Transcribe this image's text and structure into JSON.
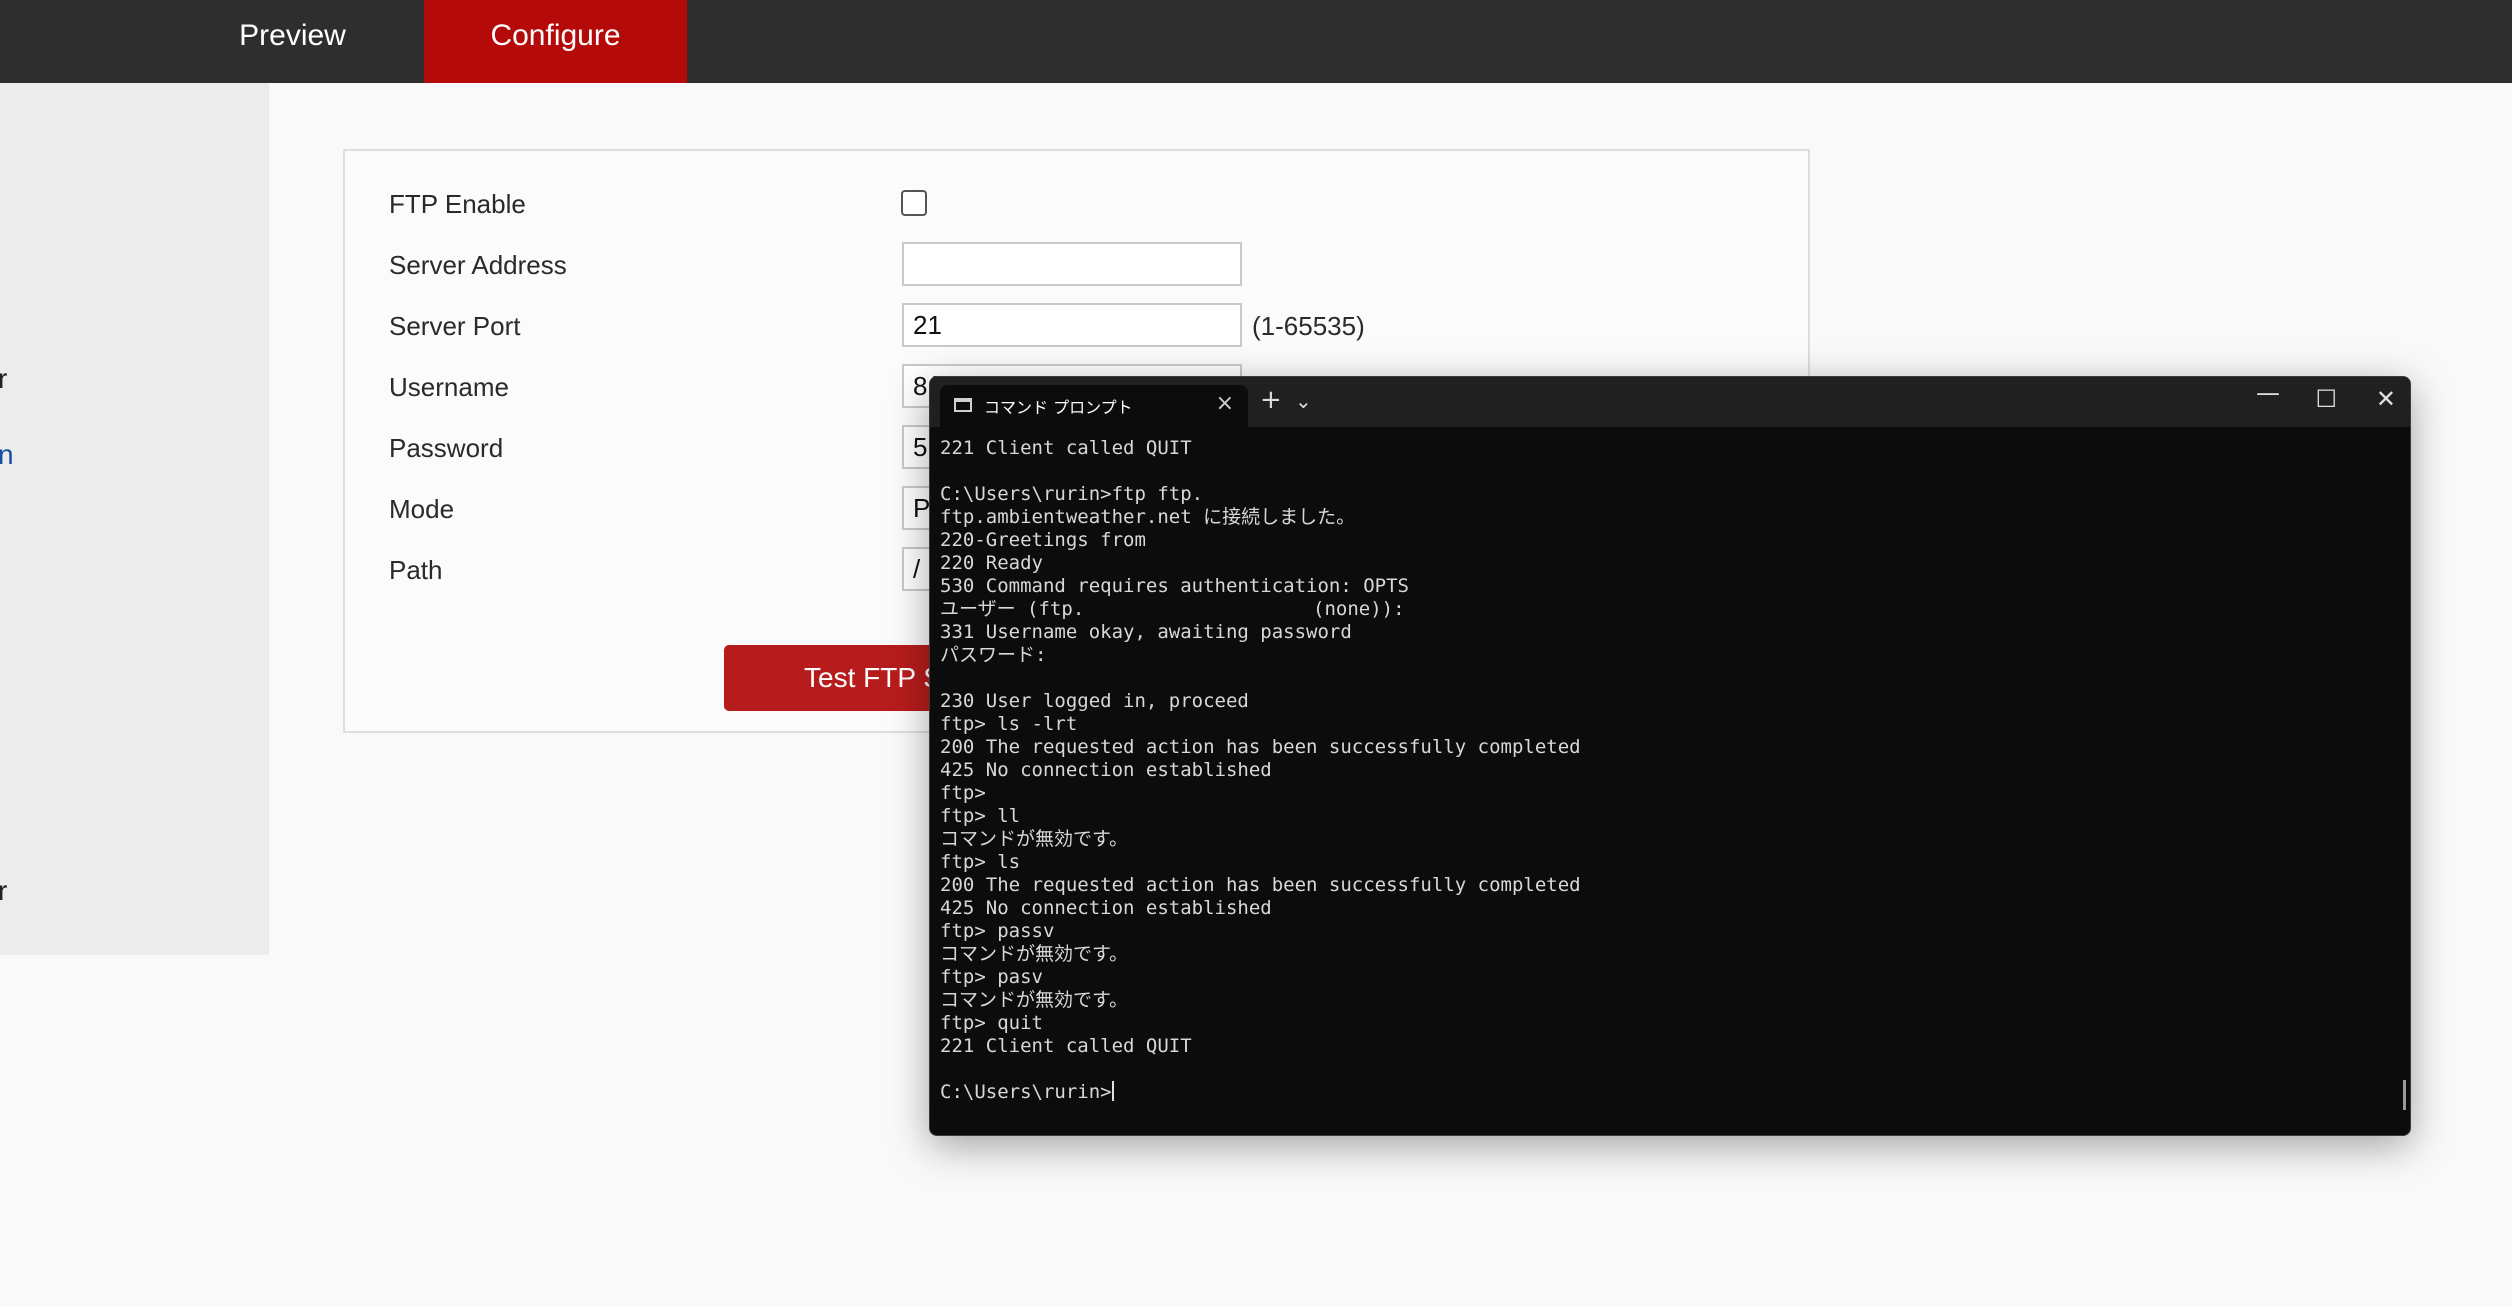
{
  "nav": {
    "preview": "Preview",
    "configure": "Configure"
  },
  "sidebar": {
    "items": [
      "r",
      "n",
      "r"
    ]
  },
  "ftp_form": {
    "enable_label": "FTP Enable",
    "enable_checked": false,
    "server_address_label": "Server Address",
    "server_address_value": "",
    "server_port_label": "Server Port",
    "server_port_value": "21",
    "server_port_range": "(1-65535)",
    "username_label": "Username",
    "username_value": "8(",
    "password_label": "Password",
    "password_value": "5l",
    "mode_label": "Mode",
    "mode_value": "P",
    "path_label": "Path",
    "path_value": "/",
    "test_button": "Test FTP S"
  },
  "terminal": {
    "tab_title": "コマンド プロンプト",
    "tab_close": "×",
    "new_tab": "+",
    "dropdown": "⌄",
    "minimize": "—",
    "maximize": "☐",
    "close": "✕",
    "output": "221 Client called QUIT\n\nC:\\Users\\rurin>ftp ftp.\nftp.ambientweather.net に接続しました。\n220-Greetings from\n220 Ready\n530 Command requires authentication: OPTS\nユーザー (ftp.                    (none)):\n331 Username okay, awaiting password\nパスワード:\n\n230 User logged in, proceed\nftp> ls -lrt\n200 The requested action has been successfully completed\n425 No connection established\nftp>\nftp> ll\nコマンドが無効です。\nftp> ls\n200 The requested action has been successfully completed\n425 No connection established\nftp> passv\nコマンドが無効です。\nftp> pasv\nコマンドが無効です。\nftp> quit\n221 Client called QUIT\n\nC:\\Users\\rurin>"
  }
}
